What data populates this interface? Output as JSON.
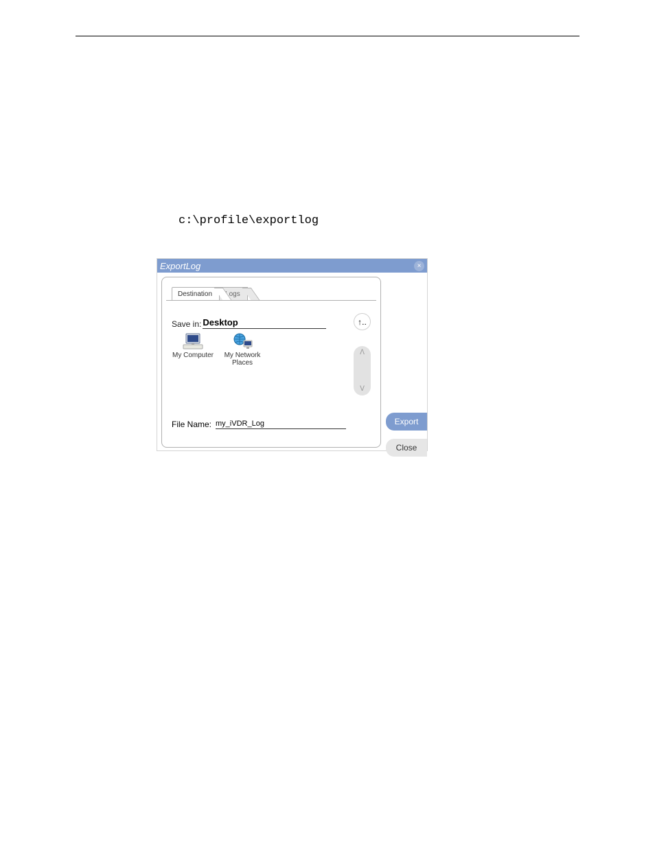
{
  "document": {
    "path_text": "c:\\profile\\exportlog"
  },
  "dialog": {
    "title": "ExportLog",
    "tabs": {
      "destination": "Destination",
      "logs": "Logs"
    },
    "save_in": {
      "label": "Save in:",
      "value": "Desktop"
    },
    "up_glyph": "↑..",
    "icons": {
      "my_computer": "My Computer",
      "my_network_places": "My Network Places"
    },
    "scroll": {
      "up": "ᐱ",
      "down": "ᐯ"
    },
    "file_name": {
      "label": "File Name:",
      "value": "my_iVDR_Log"
    },
    "buttons": {
      "export": "Export",
      "close": "Close"
    },
    "close_x": "×"
  }
}
